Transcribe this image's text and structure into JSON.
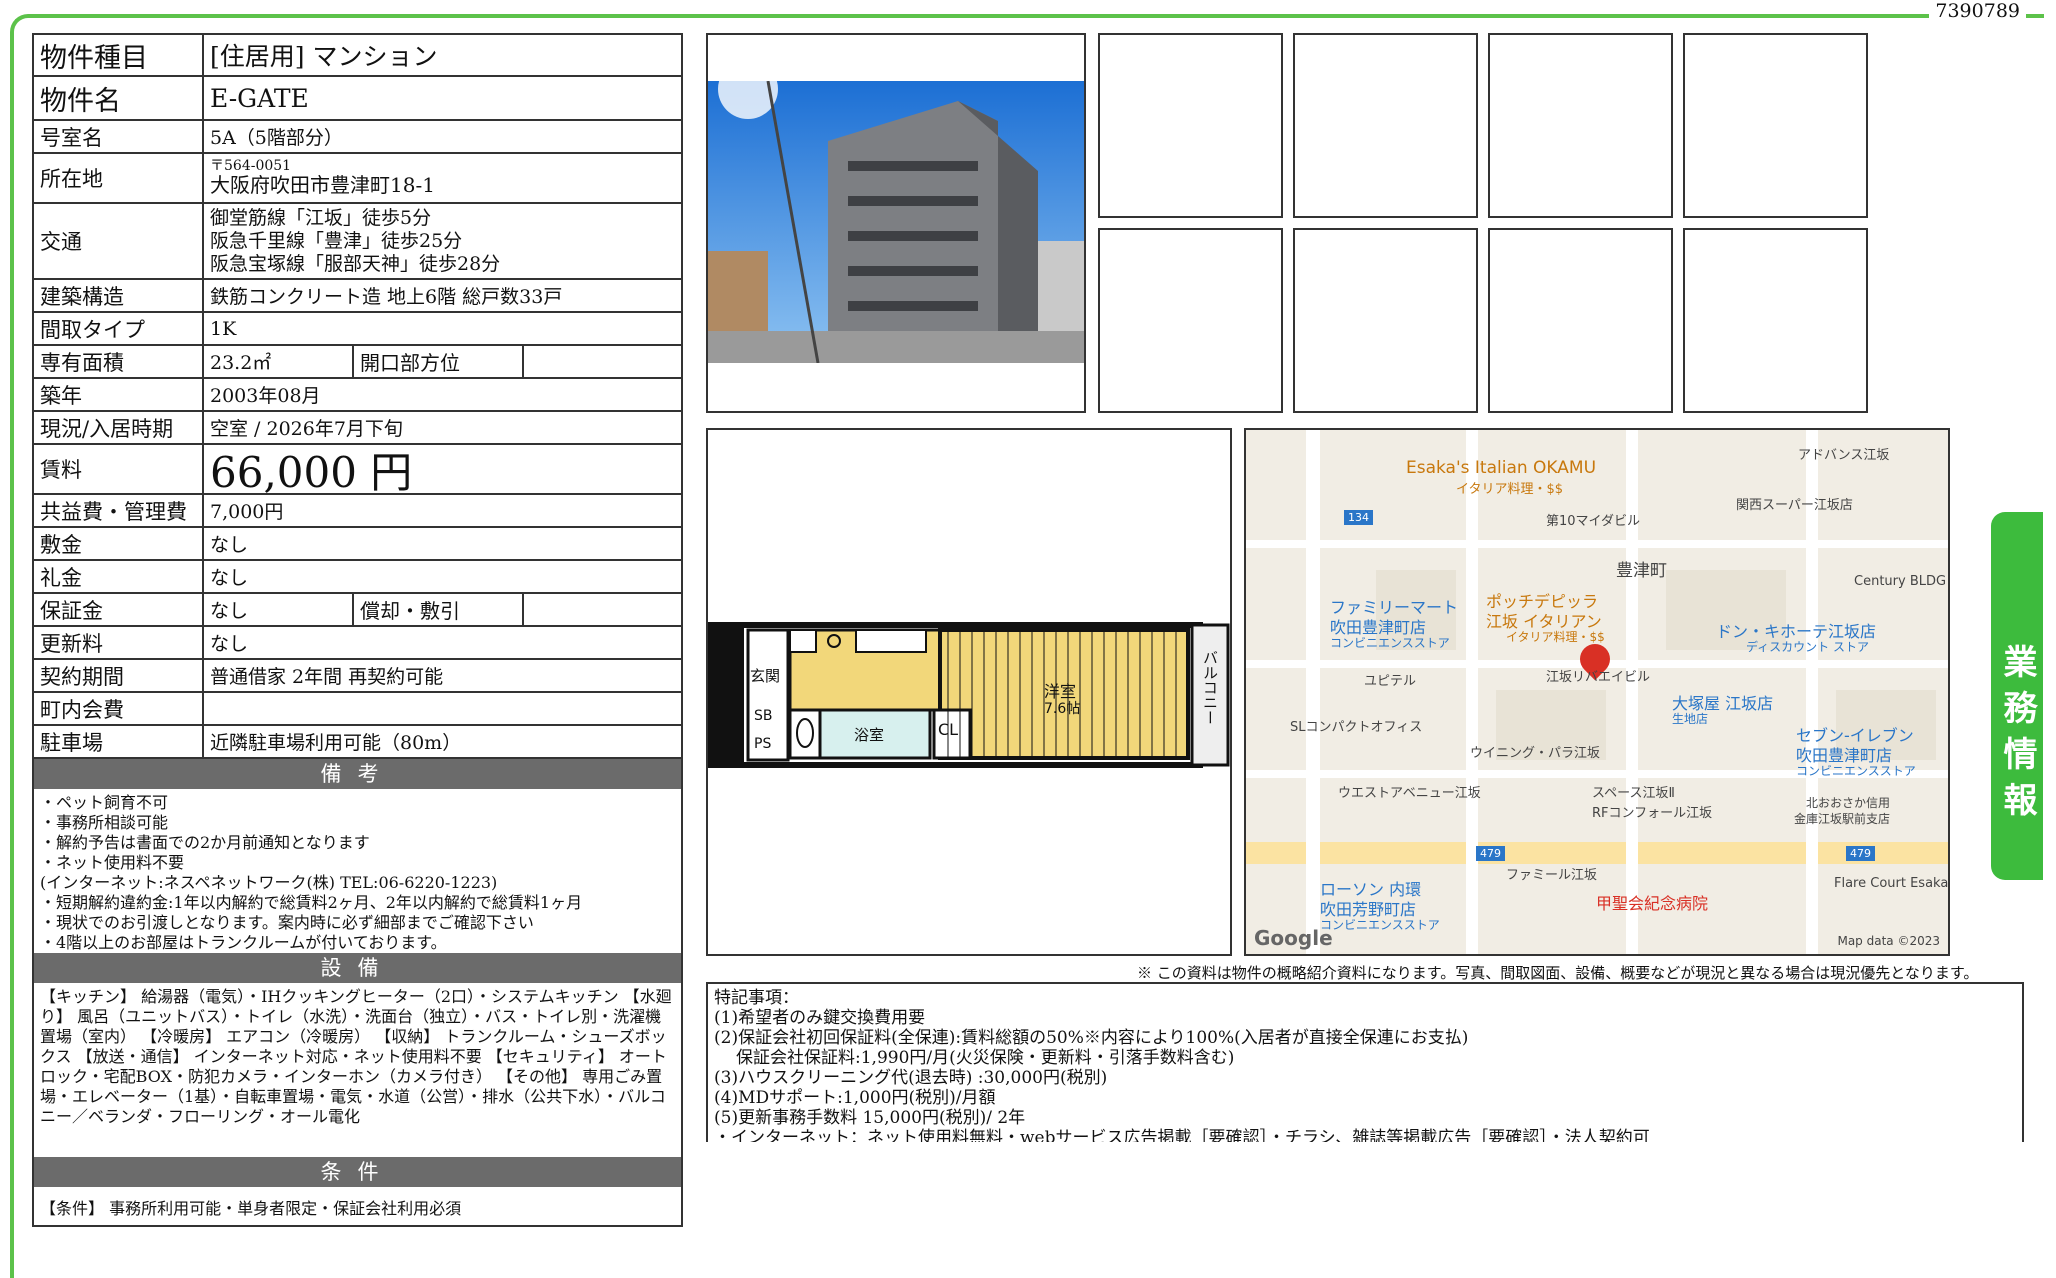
{
  "page_id": "7390789",
  "side_tab": "業務情報",
  "info": {
    "property_type": {
      "label": "物件種目",
      "value": "[住居用] マンション"
    },
    "property_name": {
      "label": "物件名",
      "value": "E-GATE"
    },
    "room_no": {
      "label": "号室名",
      "value": "5A（5階部分）"
    },
    "address": {
      "label": "所在地",
      "postal": "〒564-0051",
      "value": "大阪府吹田市豊津町18-1"
    },
    "access": {
      "label": "交通",
      "lines": [
        "御堂筋線「江坂」徒歩5分",
        "阪急千里線「豊津」徒歩25分",
        "阪急宝塚線「服部天神」徒歩28分"
      ]
    },
    "structure": {
      "label": "建築構造",
      "value": "鉄筋コンクリート造 地上6階 総戸数33戸"
    },
    "layout": {
      "label": "間取タイプ",
      "value": "1K"
    },
    "area": {
      "label": "専有面積",
      "value": "23.2㎡",
      "sub_label": "開口部方位",
      "sub_value": ""
    },
    "built": {
      "label": "築年",
      "value": "2003年08月"
    },
    "status": {
      "label": "現況/入居時期",
      "value": "空室 / 2026年7月下旬"
    },
    "rent": {
      "label": "賃料",
      "value": "66,000 円"
    },
    "common_fee": {
      "label": "共益費・管理費",
      "value": "7,000円"
    },
    "deposit": {
      "label": "敷金",
      "value": "なし"
    },
    "key_money": {
      "label": "礼金",
      "value": "なし"
    },
    "guarantee": {
      "label": "保証金",
      "value": "なし",
      "sub_label": "償却・敷引",
      "sub_value": ""
    },
    "renewal": {
      "label": "更新料",
      "value": "なし"
    },
    "contract": {
      "label": "契約期間",
      "value": "普通借家 2年間 再契約可能"
    },
    "town_fee": {
      "label": "町内会費",
      "value": ""
    },
    "parking": {
      "label": "駐車場",
      "value": "近隣駐車場利用可能（80m）"
    }
  },
  "remarks": {
    "title": "備考",
    "lines": [
      "・ペット飼育不可",
      "・事務所相談可能",
      "・解約予告は書面での2か月前通知となります",
      "・ネット使用料不要",
      "(インターネット:ネスペネットワーク(株) TEL:06-6220-1223)",
      "・短期解約違約金:1年以内解約で総賃料2ヶ月、2年以内解約で総賃料1ヶ月",
      "・現状でのお引渡しとなります。案内時に必ず細部までご確認下さい",
      "・4階以上のお部屋はトランクルームが付いております。"
    ]
  },
  "equipment": {
    "title": "設備",
    "text": "【キッチン】 給湯器（電気）・IHクッキングヒーター（2口）・システムキッチン 【水廻り】 風呂（ユニットバス）・トイレ（水洗）・洗面台（独立）・バス・トイレ別・洗濯機置場（室内） 【冷暖房】 エアコン（冷暖房） 【収納】 トランクルーム・シューズボックス 【放送・通信】 インターネット対応・ネット使用料不要 【セキュリティ】 オートロック・宅配BOX・防犯カメラ・インターホン（カメラ付き） 【その他】 専用ごみ置場・エレベーター（1基）・自転車置場・電気・水道（公営）・排水（公共下水）・バルコニー／ベランダ・フローリング・オール電化"
  },
  "conditions": {
    "title": "条件",
    "text": "【条件】 事務所利用可能・単身者限定・保証会社利用必須"
  },
  "floorplan": {
    "rooms": {
      "entrance": "玄関",
      "western": "洋室",
      "western_size": "7.6帖",
      "bath": "浴室",
      "closet": "CL",
      "sb": "SB",
      "ps": "PS",
      "balcony": "バルコニー"
    }
  },
  "map": {
    "labels": {
      "okamu": "Esaka's Italian OKAMU",
      "okamu_sub": "イタリア料理・$$",
      "advance": "アドバンス江坂",
      "kansai_super": "関西スーパー江坂店",
      "mydeal10": "第10マイダビル",
      "toyotsu": "豊津町",
      "century": "Century BLDG",
      "familymart": "ファミリーマート",
      "familymart2": "吹田豊津町店",
      "familymart_sub": "コンビニエンスストア",
      "pocchi": "ポッチデピッラ",
      "pocchi2": "江坂 イタリアン",
      "pocchi_sub": "イタリア料理・$$",
      "donki": "ドン・キホーテ江坂店",
      "donki_sub": "ディスカウント ストア",
      "utepl": "ユピテル",
      "esaka_ribel": "江坂リバエイビル",
      "otsukaya": "大塚屋 江坂店",
      "otsukaya_sub": "生地店",
      "seven": "セブン-イレブン",
      "seven2": "吹田豊津町店",
      "seven_sub": "コンビニエンスストア",
      "sl": "SLコンパクトオフィス",
      "winning": "ウイニング・パラ江坂",
      "west": "ウエストアベニュー江坂",
      "space": "スペース江坂Ⅱ",
      "rf": "RFコンフォール江坂",
      "shinkin": "北おおさか信用",
      "shinkin2": "金庫江坂駅前支店",
      "famille": "ファミール江坂",
      "lawson": "ローソン 内環",
      "lawson2": "吹田芳野町店",
      "lawson_sub": "コンビニエンスストア",
      "hospital": "甲聖会紀念病院",
      "flare": "Flare Court Esaka",
      "road134": "134",
      "road479a": "479",
      "road479b": "479",
      "google": "Google",
      "mapdata": "Map data ©2023"
    }
  },
  "disclaimer": "※ この資料は物件の概略紹介資料になります。写真、間取図面、設備、概要などが現況と異なる場合は現況優先となります。",
  "notes": {
    "lines": [
      "特記事項：",
      "(1)希望者のみ鍵交換費用要",
      "(2)保証会社初回保証料(全保連):賃料総額の50%※内容により100%(入居者が直接全保連にお支払)",
      "保証会社保証料:1,990円/月(火災保険・更新料・引落手数料含む)",
      "(3)ハウスクリーニング代(退去時) :30,000円(税別)",
      "(4)MDサポート:1,000円(税別)/月額",
      "(5)更新事務手数料 15,000円(税別)/ 2年",
      "・インターネット：ネット使用料無料・webサービス広告掲載［要確認］・チラシ、雑誌等掲載広告［要確認］・法人契約可"
    ]
  }
}
